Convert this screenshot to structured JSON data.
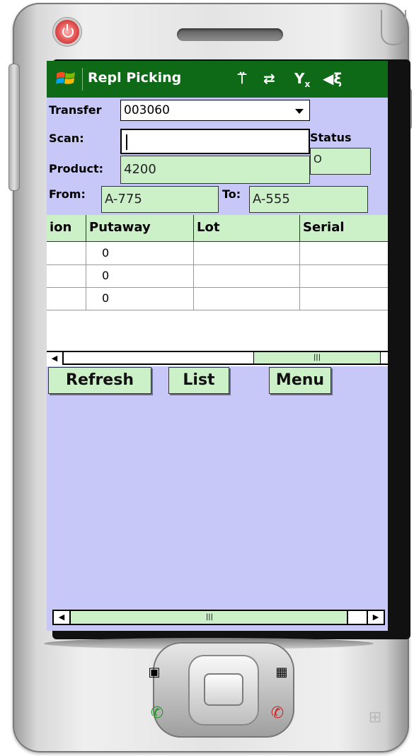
{
  "app": {
    "title": "Repl Picking"
  },
  "status_icons": [
    "antenna-icon",
    "sync-icon",
    "no-signal-icon",
    "volume-icon"
  ],
  "form": {
    "transfer_label": "Transfer",
    "transfer_value": "003060",
    "scan_label": "Scan:",
    "scan_value": "",
    "status_label": "Status",
    "status_value": "O",
    "product_label": "Product:",
    "product_value": "4200",
    "from_label": "From:",
    "from_value": "A-775",
    "to_label": "To:",
    "to_value": "A-555"
  },
  "grid": {
    "columns": [
      "ion",
      "Putaway",
      "Lot",
      "Serial"
    ],
    "rows": [
      {
        "location": "",
        "putaway": "0",
        "lot": "",
        "serial": ""
      },
      {
        "location": "",
        "putaway": "0",
        "lot": "",
        "serial": ""
      },
      {
        "location": "",
        "putaway": "0",
        "lot": "",
        "serial": ""
      }
    ]
  },
  "buttons": {
    "refresh": "Refresh",
    "list": "List",
    "menu": "Menu"
  },
  "colors": {
    "titlebar": "#0f6a18",
    "screen_bg": "#c8c8f8",
    "field_bg": "#ccf0c8",
    "power": "#e25050"
  }
}
